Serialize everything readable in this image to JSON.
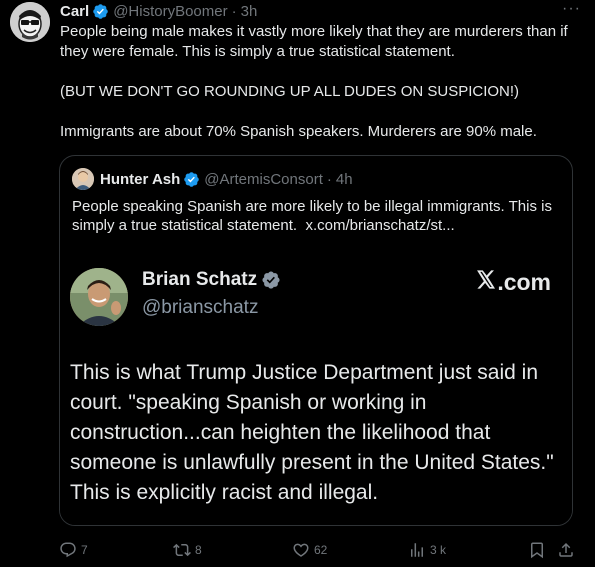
{
  "post": {
    "author_name": "Carl",
    "author_handle": "@HistoryBoomer",
    "separator": "·",
    "time": "3h",
    "more": "···",
    "paragraphs": [
      "People being male makes it vastly more likely that they are murderers than if they were female. This is simply a true statistical statement.",
      "(BUT WE DON'T GO ROUNDING UP ALL DUDES ON SUSPICION!)",
      "Immigrants are about 70% Spanish speakers. Murderers are 90% male."
    ]
  },
  "quote": {
    "author_name": "Hunter Ash",
    "author_handle": "@ArtemisConsort",
    "separator": "·",
    "time": "4h",
    "text": "People speaking Spanish are more likely to be illegal immigrants. This is simply a true statistical statement.",
    "link": "x.com/brianschatz/st..."
  },
  "media": {
    "name": "Brian Schatz",
    "handle": "@brianschatz",
    "brand": ".com",
    "text": "This is what Trump Justice Department just said in court.  \"speaking Spanish or working in construction...can heighten the likelihood that someone is unlawfully present in the United States.\" This is explicitly racist and illegal."
  },
  "actions": {
    "reply_count": "7",
    "repost_count": "8",
    "like_count": "62",
    "views_count": "3 k"
  },
  "icons": {
    "verified": "verified-badge-icon",
    "reply": "reply-icon",
    "repost": "repost-icon",
    "like": "heart-icon",
    "views": "views-icon",
    "bookmark": "bookmark-icon",
    "share": "share-icon"
  },
  "colors": {
    "background": "#000000",
    "text": "#e7e9ea",
    "muted": "#71767b",
    "verified": "#1d9bf0",
    "border": "#2f3336"
  }
}
